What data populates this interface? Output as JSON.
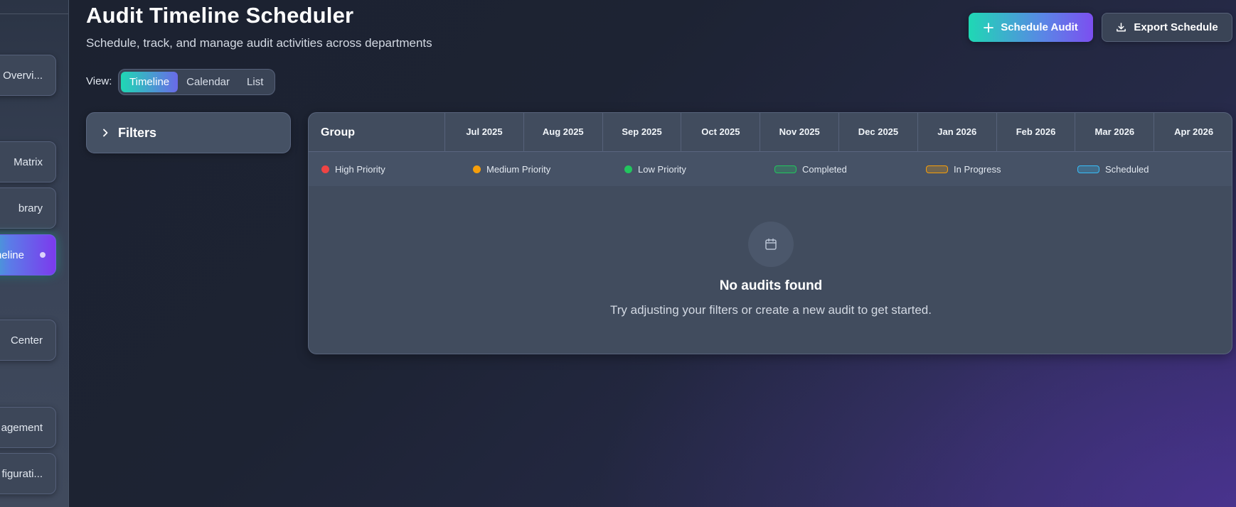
{
  "sidebar": {
    "items": [
      {
        "label": "Overvi...",
        "active": false
      },
      {
        "label": "Matrix",
        "active": false
      },
      {
        "label": "brary",
        "active": false
      },
      {
        "label": "neline",
        "active": true
      },
      {
        "label": "Center",
        "active": false
      },
      {
        "label": "agement",
        "active": false
      },
      {
        "label": "figurati...",
        "active": false
      }
    ]
  },
  "header": {
    "title": "Audit Timeline Scheduler",
    "subtitle": "Schedule, track, and manage audit activities across departments",
    "schedule_button": "Schedule Audit",
    "schedule_icon": "plus-icon",
    "export_button": "Export Schedule",
    "export_icon": "download-icon"
  },
  "view": {
    "label": "View:",
    "options": [
      "Timeline",
      "Calendar",
      "List"
    ],
    "selected": "Timeline"
  },
  "filters": {
    "label": "Filters",
    "icon": "chevron-right-icon"
  },
  "timeline": {
    "group_header": "Group",
    "months": [
      "Jul 2025",
      "Aug 2025",
      "Sep 2025",
      "Oct 2025",
      "Nov 2025",
      "Dec 2025",
      "Jan 2026",
      "Feb 2026",
      "Mar 2026",
      "Apr 2026"
    ],
    "legend": [
      {
        "label": "High Priority",
        "kind": "dot",
        "color": "#ef4444"
      },
      {
        "label": "Medium Priority",
        "kind": "dot",
        "color": "#f59e0b"
      },
      {
        "label": "Low Priority",
        "kind": "dot",
        "color": "#22c55e"
      },
      {
        "label": "Completed",
        "kind": "bar",
        "color": "#22c55e"
      },
      {
        "label": "In Progress",
        "kind": "bar",
        "color": "#f59e0b"
      },
      {
        "label": "Scheduled",
        "kind": "bar",
        "color": "#38bdf8"
      }
    ],
    "empty_state": {
      "icon": "calendar-icon",
      "title": "No audits found",
      "text": "Try adjusting your filters or create a new audit to get started."
    }
  },
  "colors": {
    "accent_start": "#1fd8b4",
    "accent_end": "#7c4ff0"
  }
}
